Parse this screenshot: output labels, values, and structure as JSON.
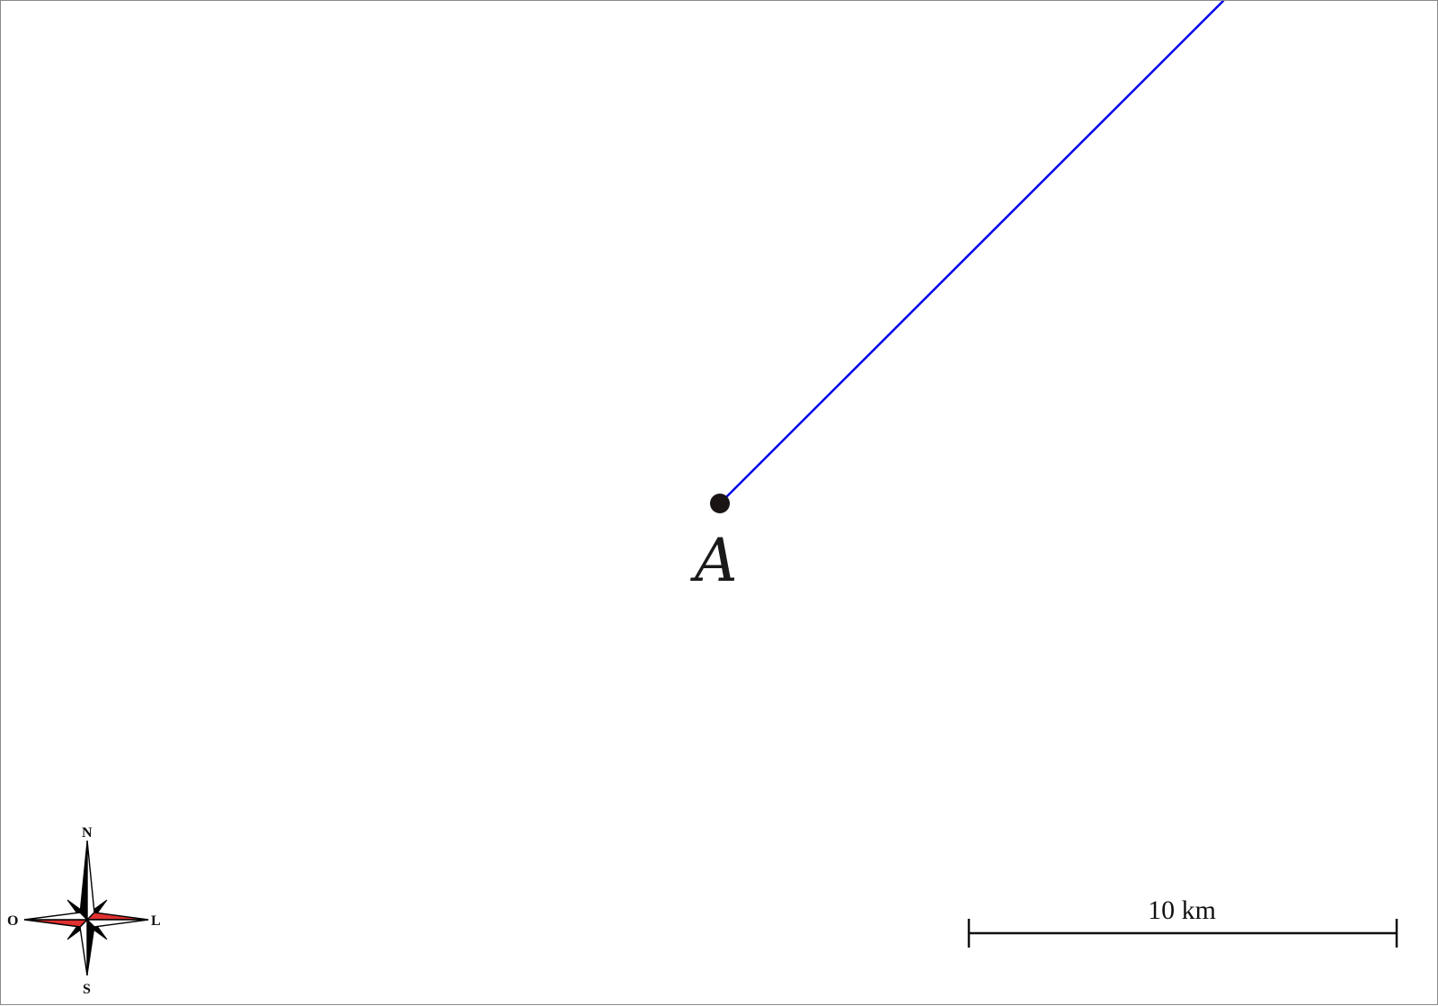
{
  "diagram": {
    "point": {
      "label": "A"
    },
    "colors": {
      "ray": "#0000ee",
      "point": "#1a1414",
      "compass_accent": "#e03030",
      "compass_dark": "#000000",
      "frame": "#8a8a8a"
    },
    "compass": {
      "north": "N",
      "south": "S",
      "east": "L",
      "west": "O"
    },
    "scale_bar": {
      "label": "10 km"
    }
  }
}
